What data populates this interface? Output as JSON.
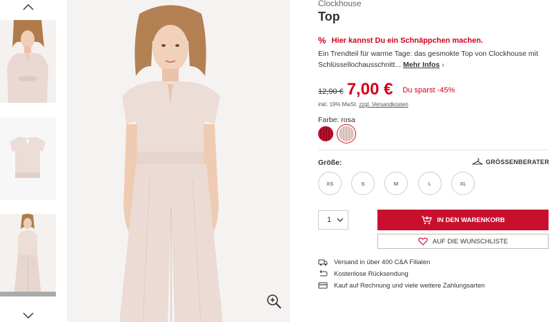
{
  "gallery": {
    "up_arrow_icon": "chevron-up-icon",
    "down_arrow_icon": "chevron-down-icon",
    "thumbnails": [
      "model-wearing-top",
      "top-flat-lay",
      "model-full-outfit"
    ],
    "zoom_icon": "zoom-in-icon"
  },
  "product": {
    "brand": "Clockhouse",
    "title": "Top",
    "deal_icon": "%",
    "deal_text": "Hier kannst Du ein Schnäppchen machen.",
    "description": "Ein Trendteil für warme Tage: das gesmokte Top von Clockhouse mit Schlüssellochausschnitt...",
    "more_info": "Mehr Infos",
    "old_price": "12,90 €",
    "new_price": "7,00 €",
    "saving": "Du sparst -45%",
    "vat_text": "inkl. 19% MwSt.",
    "shipping_link": "zzgl. Versandkosten",
    "color_label": "Farbe: rosa",
    "colors": [
      {
        "name": "rot",
        "hex": "#c8102e",
        "selected": false
      },
      {
        "name": "rosa",
        "hex": "#e6d3cc",
        "selected": true
      }
    ],
    "size_label": "Größe:",
    "size_guide": "GRÖSSENBERATER",
    "sizes": [
      "XS",
      "S",
      "M",
      "L",
      "XL"
    ],
    "quantity": "1",
    "add_to_cart": "IN DEN WARENKORB",
    "add_to_wishlist": "AUF DIE WUNSCHLISTE",
    "features": [
      "Versand in über 400 C&A Filialen",
      "Kostenlose Rücksendung",
      "Kauf auf Rechnung und viele weitere Zahlungsarten"
    ]
  },
  "colors": {
    "accent": "#c8102e",
    "price_red": "#d2001a"
  }
}
